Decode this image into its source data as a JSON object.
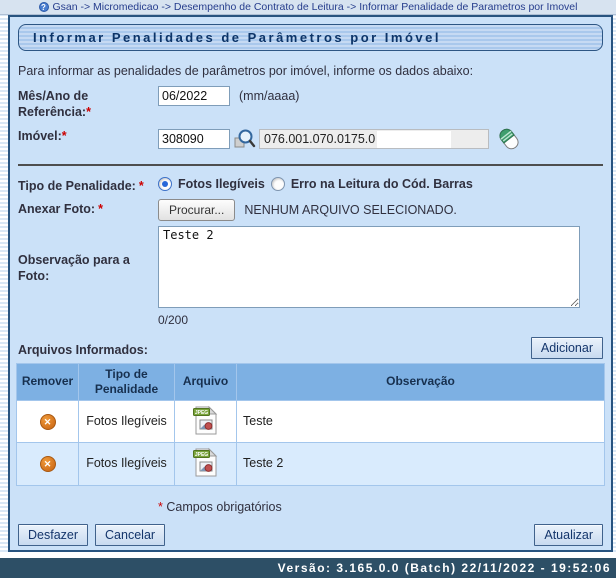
{
  "breadcrumb": {
    "help_icon": "?",
    "text": "Gsan -> Micromedicao -> Desempenho de Contrato de Leitura -> Informar Penalidade de Parametros por Imovel"
  },
  "page": {
    "title": "Informar Penalidades de Parâmetros por Imóvel",
    "description": "Para informar as penalidades de parâmetros por imóvel, informe os dados abaixo:",
    "required_marker": "*",
    "required_note": "Campos obrigatórios"
  },
  "form": {
    "mes_ano": {
      "label": "Mês/Ano de Referência:",
      "value": "06/2022",
      "hint": "(mm/aaaa)"
    },
    "imovel": {
      "label": "Imóvel:",
      "value": "308090",
      "matricula": "076.001.070.0175.0"
    },
    "tipo_penalidade": {
      "label": "Tipo de Penalidade:",
      "option1": "Fotos Ilegíveis",
      "option2": "Erro na Leitura do Cód. Barras"
    },
    "anexar_foto": {
      "label": "Anexar Foto:",
      "browse_button": "Procurar...",
      "status": "NENHUM ARQUIVO SELECIONADO."
    },
    "observacao": {
      "label": "Observação para a Foto:",
      "value": "Teste 2",
      "counter": "0/200"
    }
  },
  "files": {
    "label": "Arquivos Informados:",
    "add_button": "Adicionar",
    "headers": [
      "Remover",
      "Tipo de Penalidade",
      "Arquivo",
      "Observação"
    ],
    "rows": [
      {
        "tipo": "Fotos Ilegíveis",
        "file_type": "JPEG",
        "observacao": "Teste"
      },
      {
        "tipo": "Fotos Ilegíveis",
        "file_type": "JPEG",
        "observacao": "Teste 2"
      }
    ]
  },
  "actions": {
    "undo": "Desfazer",
    "cancel": "Cancelar",
    "update": "Atualizar"
  },
  "footer": {
    "version": "Versão: 3.165.0.0 (Batch) 22/11/2022 - 19:52:06"
  },
  "colors": {
    "panel_bg": "#cbe1f8",
    "panel_border": "#27537f",
    "title_text": "#0c3468",
    "table_header_bg": "#7db0e3",
    "row_alt_bg": "#d9ebfd",
    "footer_bg": "#2d4f66",
    "required_red": "#cc0000",
    "remove_icon_orange": "#d2711c",
    "breadcrumb_text": "#253c8c"
  }
}
